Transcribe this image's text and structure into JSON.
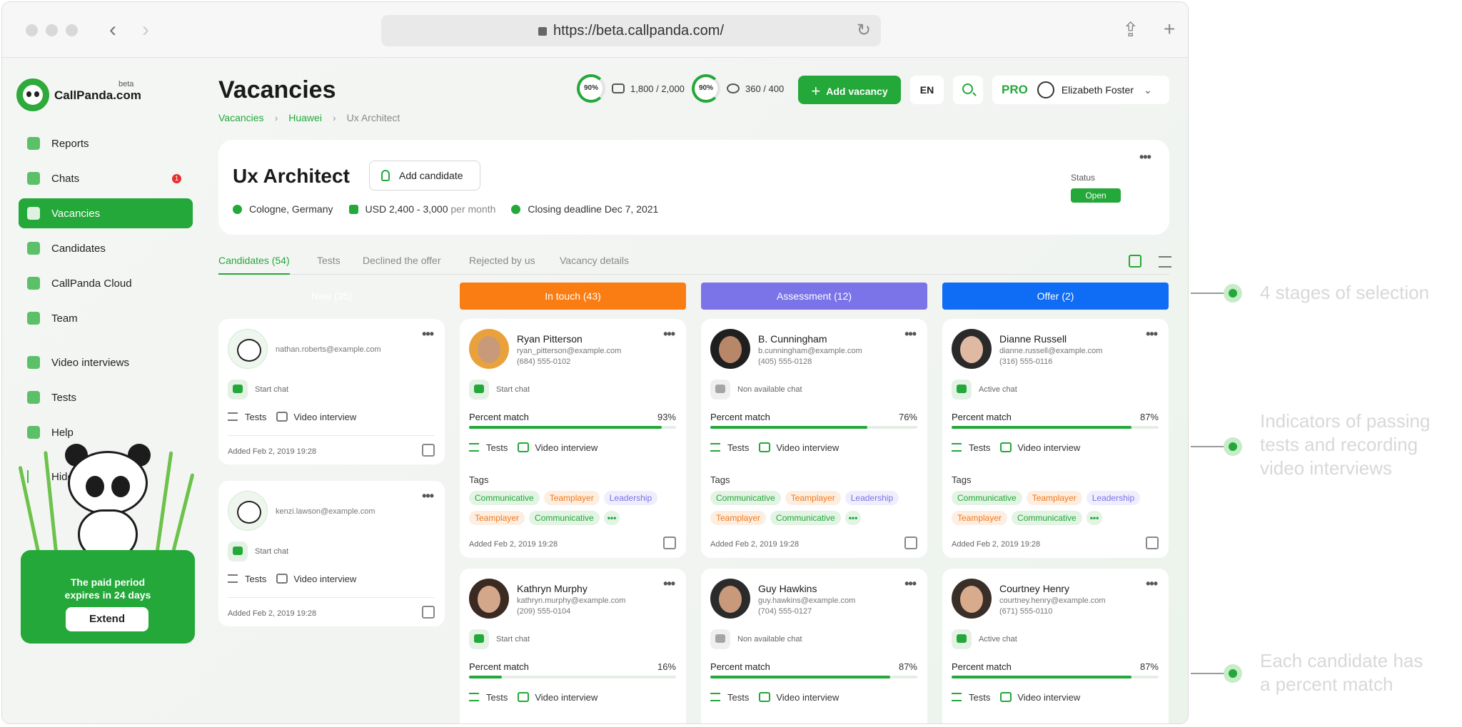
{
  "browser": {
    "url": "https://beta.callpanda.com/"
  },
  "sidebar": {
    "logo_text": "CallPanda.com",
    "logo_beta": "beta",
    "items": [
      {
        "label": "Reports"
      },
      {
        "label": "Chats",
        "badge": "1"
      },
      {
        "label": "Vacancies"
      },
      {
        "label": "Candidates"
      },
      {
        "label": "CallPanda Cloud"
      },
      {
        "label": "Team"
      },
      {
        "label": "Video interviews"
      },
      {
        "label": "Tests"
      },
      {
        "label": "Help"
      },
      {
        "label": "Hide"
      }
    ],
    "promo": {
      "text_line1": "The paid period",
      "text_line2": "expires in 24 days",
      "button": "Extend"
    }
  },
  "header": {
    "title": "Vacancies",
    "breadcrumb": [
      "Vacancies",
      "Huawei",
      "Ux Architect"
    ],
    "quota1": {
      "percent": "90%",
      "value": "1,800 / 2,000"
    },
    "quota2": {
      "percent": "90%",
      "value": "360 / 400"
    },
    "add_vacancy": "Add vacancy",
    "lang": "EN",
    "plan": "PRO",
    "user_name": "Elizabeth Foster"
  },
  "vacancy": {
    "title": "Ux Architect",
    "add_candidate": "Add candidate",
    "location": "Cologne, Germany",
    "salary": "USD 2,400 - 3,000",
    "salary_period": "per month",
    "deadline": "Closing deadline Dec 7, 2021",
    "status_label": "Status",
    "status": "Open"
  },
  "tabs": [
    "Candidates (54)",
    "Tests",
    "Declined the offer",
    "Rejected by us",
    "Vacancy details"
  ],
  "columns": [
    {
      "title": "New (35)",
      "color": "#23a839"
    },
    {
      "title": "In touch (43)",
      "color": "#f97d13"
    },
    {
      "title": "Assessment (12)",
      "color": "#7b74e8"
    },
    {
      "title": "Offer (2)",
      "color": "#0f6cf5"
    }
  ],
  "labels": {
    "percent_match": "Percent match",
    "tests": "Tests",
    "video_interview": "Video interview",
    "tags": "Tags"
  },
  "cards": {
    "new": [
      {
        "email": "nathan.roberts@example.com",
        "chat": "Start chat",
        "added": "Added Feb 2, 2019 19:28"
      },
      {
        "email": "kenzi.lawson@example.com",
        "chat": "Start chat",
        "added": "Added Feb 2, 2019 19:28"
      }
    ],
    "touch": [
      {
        "name": "Ryan Pitterson",
        "email": "ryan_pitterson@example.com",
        "phone": "(684) 555-0102",
        "chat": "Start chat",
        "match": "93%",
        "match_value": 0.93,
        "tags": [
          "Communicative",
          "Teamplayer",
          "Leadership",
          "Teamplayer",
          "Communicative"
        ],
        "added": "Added Feb 2, 2019 19:28"
      },
      {
        "name": "Kathryn Murphy",
        "email": "kathryn.murphy@example.com",
        "phone": "(209) 555-0104",
        "chat": "Start chat",
        "match": "16%",
        "match_value": 0.16
      }
    ],
    "assess": [
      {
        "name": "B. Cunningham",
        "email": "b.cunningham@example.com",
        "phone": "(405) 555-0128",
        "chat": "Non available chat",
        "match": "76%",
        "match_value": 0.76,
        "tags": [
          "Communicative",
          "Teamplayer",
          "Leadership",
          "Teamplayer",
          "Communicative"
        ],
        "added": "Added Feb 2, 2019 19:28"
      },
      {
        "name": "Guy Hawkins",
        "email": "guy.hawkins@example.com",
        "phone": "(704) 555-0127",
        "chat": "Non available chat",
        "match": "87%",
        "match_value": 0.87
      }
    ],
    "offer": [
      {
        "name": "Dianne Russell",
        "email": "dianne.russell@example.com",
        "phone": "(316) 555-0116",
        "chat": "Active chat",
        "match": "87%",
        "match_value": 0.87,
        "tags": [
          "Communicative",
          "Teamplayer",
          "Leadership",
          "Teamplayer",
          "Communicative"
        ],
        "added": "Added Feb 2, 2019 19:28"
      },
      {
        "name": "Courtney Henry",
        "email": "courtney.henry@example.com",
        "phone": "(671) 555-0110",
        "chat": "Active chat",
        "match": "87%",
        "match_value": 0.87
      }
    ]
  },
  "annotations": [
    {
      "line1": "4 stages of selection"
    },
    {
      "line1": "Indicators of passing",
      "line2": "tests and recording",
      "line3": "video interviews"
    },
    {
      "line1": "Each candidate has",
      "line2": "a percent match"
    }
  ]
}
